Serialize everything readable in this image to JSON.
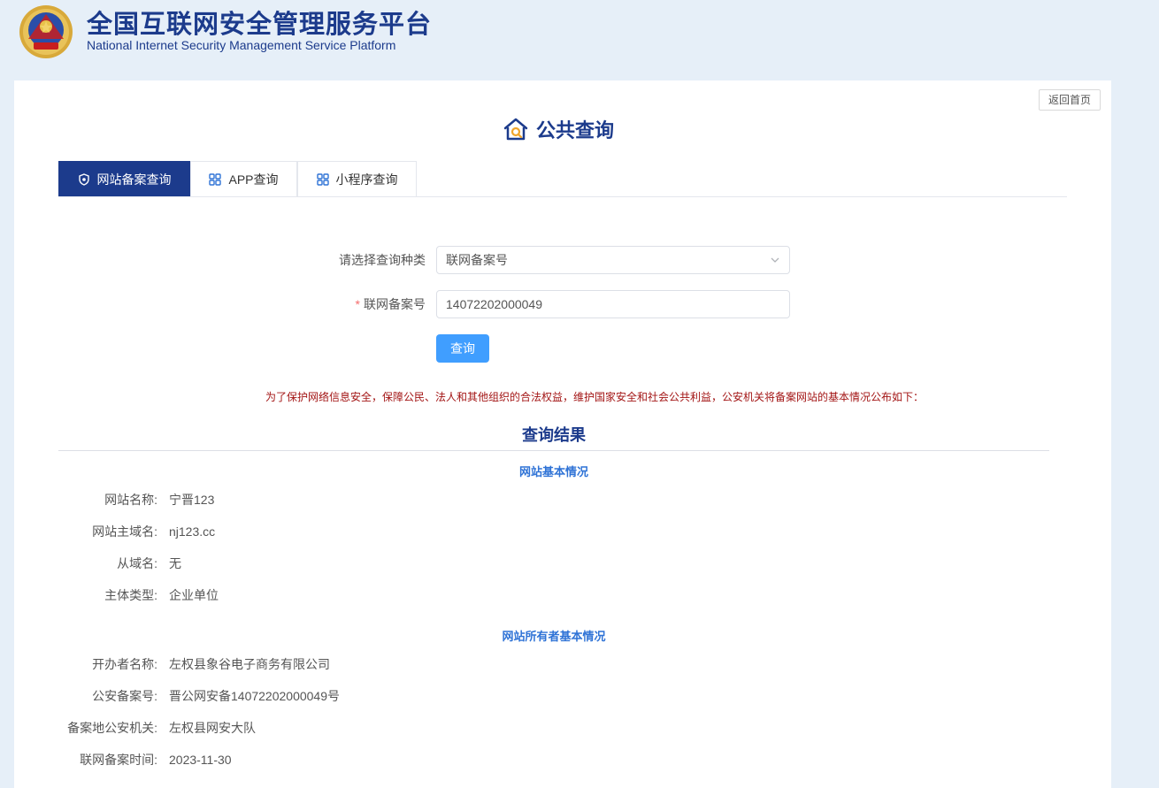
{
  "header": {
    "title": "全国互联网安全管理服务平台",
    "subtitle": "National Internet Security Management Service Platform"
  },
  "back_button": "返回首页",
  "page_heading": "公共查询",
  "tabs": [
    {
      "label": "网站备案查询",
      "active": true
    },
    {
      "label": "APP查询",
      "active": false
    },
    {
      "label": "小程序查询",
      "active": false
    }
  ],
  "form": {
    "type_label": "请选择查询种类",
    "type_value": "联网备案号",
    "record_label": "联网备案号",
    "record_value": "14072202000049",
    "submit_label": "查询"
  },
  "notice": "为了保护网络信息安全，保障公民、法人和其他组织的合法权益，维护国家安全和社会公共利益，公安机关将备案网站的基本情况公布如下：",
  "results": {
    "heading": "查询结果",
    "website_section": {
      "title": "网站基本情况",
      "fields": [
        {
          "key": "网站名称:",
          "value": "宁晋123"
        },
        {
          "key": "网站主域名:",
          "value": "nj123.cc"
        },
        {
          "key": "从域名:",
          "value": "无"
        },
        {
          "key": "主体类型:",
          "value": "企业单位"
        }
      ]
    },
    "owner_section": {
      "title": "网站所有者基本情况",
      "fields": [
        {
          "key": "开办者名称:",
          "value": "左权县象谷电子商务有限公司"
        },
        {
          "key": "公安备案号:",
          "value": "晋公网安备14072202000049号"
        },
        {
          "key": "备案地公安机关:",
          "value": "左权县网安大队"
        },
        {
          "key": "联网备案时间:",
          "value": "2023-11-30"
        }
      ]
    }
  },
  "colors": {
    "brand": "#1c3b8c",
    "primary_button": "#409eff",
    "notice": "#a31515",
    "section_title": "#2f73d6"
  }
}
